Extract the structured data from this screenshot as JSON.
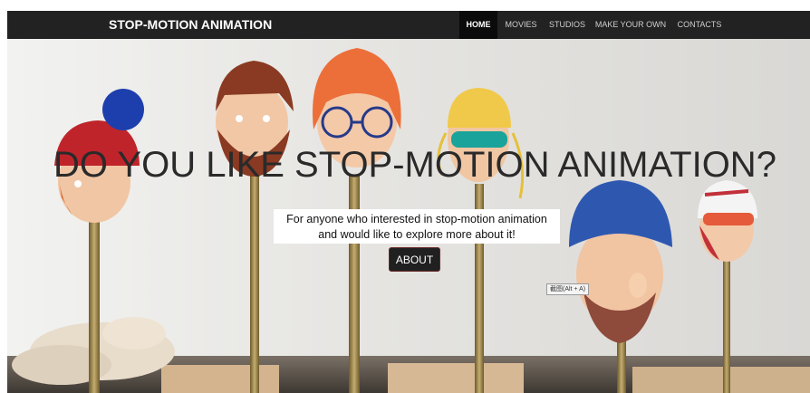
{
  "navbar": {
    "brand": "STOP-MOTION ANIMATION",
    "items": [
      {
        "label": "HOME",
        "active": true
      },
      {
        "label": "MOVIES",
        "active": false
      },
      {
        "label": "STUDIOS",
        "active": false
      },
      {
        "label": "MAKE YOUR OWN",
        "active": false
      },
      {
        "label": "CONTACTS",
        "active": false
      }
    ]
  },
  "hero": {
    "headline": "DO YOU LIKE STOP-MOTION ANIMATION?",
    "subtitle_line1": "For anyone who interested in stop-motion animation",
    "subtitle_line2": "and would like to explore more about it!",
    "button_label": "ABOUT",
    "image_description": "clay heads of stop-motion puppets on sticks"
  },
  "tooltip": {
    "text": "截图(Alt + A)"
  },
  "colors": {
    "navbar_bg": "#222222",
    "active_nav_bg": "#0b0b0b",
    "button_bg": "#202020",
    "button_border": "#6a2a2a"
  }
}
